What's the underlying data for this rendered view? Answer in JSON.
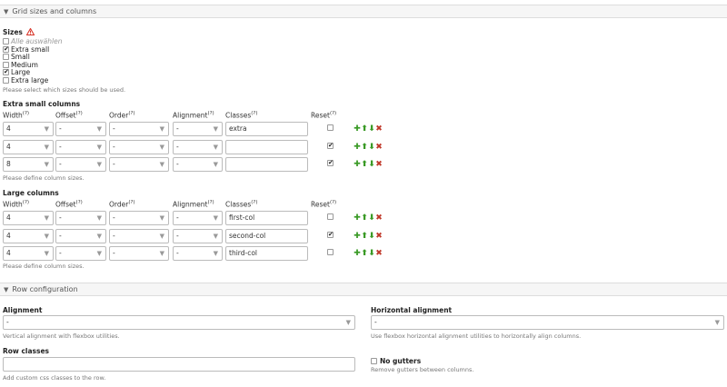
{
  "grid_section": {
    "title": "Grid sizes and columns"
  },
  "sizes": {
    "label": "Sizes",
    "options": [
      {
        "label": "Alle auswählen",
        "checked": false,
        "muted": true
      },
      {
        "label": "Extra small",
        "checked": true
      },
      {
        "label": "Small",
        "checked": false
      },
      {
        "label": "Medium",
        "checked": false
      },
      {
        "label": "Large",
        "checked": true
      },
      {
        "label": "Extra large",
        "checked": false
      }
    ],
    "help": "Please select which sizes should be used."
  },
  "columns_headers": {
    "width": "Width",
    "offset": "Offset",
    "order": "Order",
    "alignment": "Alignment",
    "classes": "Classes",
    "reset": "Reset",
    "q": "(?)"
  },
  "xs_group": {
    "title": "Extra small columns",
    "rows": [
      {
        "width": "4",
        "offset": "-",
        "order": "-",
        "alignment": "-",
        "classes": "extra",
        "reset": false
      },
      {
        "width": "4",
        "offset": "-",
        "order": "-",
        "alignment": "-",
        "classes": "",
        "reset": true
      },
      {
        "width": "8",
        "offset": "-",
        "order": "-",
        "alignment": "-",
        "classes": "",
        "reset": true
      }
    ],
    "help": "Please define column sizes."
  },
  "lg_group": {
    "title": "Large columns",
    "rows": [
      {
        "width": "4",
        "offset": "-",
        "order": "-",
        "alignment": "-",
        "classes": "first-col",
        "reset": false
      },
      {
        "width": "4",
        "offset": "-",
        "order": "-",
        "alignment": "-",
        "classes": "second-col",
        "reset": true
      },
      {
        "width": "4",
        "offset": "-",
        "order": "-",
        "alignment": "-",
        "classes": "third-col",
        "reset": false
      }
    ],
    "help": "Please define column sizes."
  },
  "row_section": {
    "title": "Row configuration"
  },
  "row_config": {
    "alignment_label": "Alignment",
    "alignment_value": "-",
    "alignment_help": "Vertical alignment with flexbox utilities.",
    "halign_label": "Horizontal alignment",
    "halign_value": "-",
    "halign_help": "Use flexbox horizontal alignment utilities to horizontally align columns.",
    "row_classes_label": "Row classes",
    "row_classes_value": "",
    "row_classes_help": "Add custom css classes to the row.",
    "no_gutters_label": "No gutters",
    "no_gutters_checked": false,
    "no_gutters_help": "Remove gutters between columns."
  },
  "icons": {
    "collapse": "triangle-down-icon",
    "warning": "warning-icon",
    "caret": "select-caret-icon",
    "add": "plus-icon",
    "up": "arrow-up-icon",
    "down": "arrow-down-icon",
    "delete": "close-icon"
  },
  "colors": {
    "add": "#3a9a26",
    "delete": "#c0392b",
    "warning": "#d9372b"
  }
}
